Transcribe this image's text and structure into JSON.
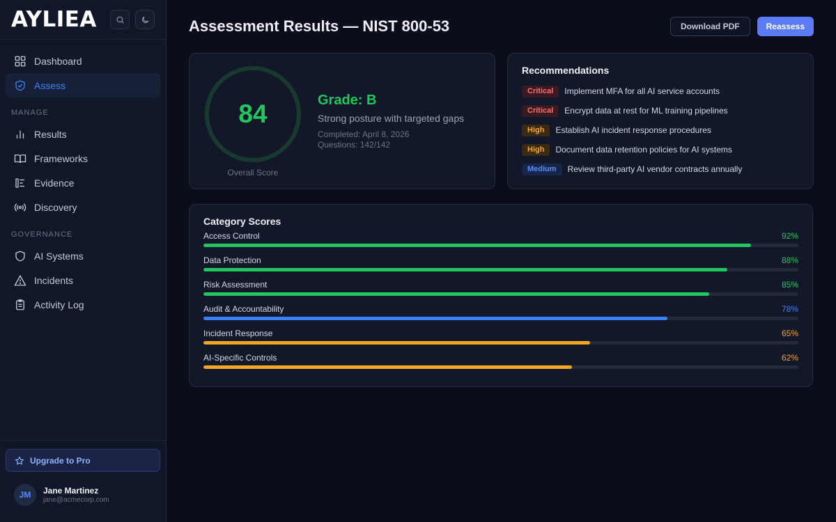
{
  "brand": {
    "name": "AYLIEA"
  },
  "sidebar": {
    "items_top": [
      {
        "label": "Dashboard",
        "icon": "grid-icon",
        "active": false
      },
      {
        "label": "Assess",
        "icon": "shield-check-icon",
        "active": true
      }
    ],
    "section_manage": "MANAGE",
    "items_manage": [
      {
        "label": "Results",
        "icon": "bar-chart-icon"
      },
      {
        "label": "Frameworks",
        "icon": "book-icon"
      },
      {
        "label": "Evidence",
        "icon": "evidence-icon"
      },
      {
        "label": "Discovery",
        "icon": "radio-waves-icon"
      }
    ],
    "section_governance": "GOVERNANCE",
    "items_governance": [
      {
        "label": "AI Systems",
        "icon": "shield-icon"
      },
      {
        "label": "Incidents",
        "icon": "alert-triangle-icon"
      },
      {
        "label": "Activity Log",
        "icon": "clipboard-icon"
      }
    ],
    "upgrade_label": "Upgrade to Pro",
    "user": {
      "initials": "JM",
      "name": "Jane Martinez",
      "email": "jane@acmecorp.com"
    }
  },
  "header": {
    "title": "Assessment Results — NIST 800-53",
    "download_label": "Download PDF",
    "reassess_label": "Reassess"
  },
  "score": {
    "value": "84",
    "fraction": 0.84,
    "label": "Overall Score",
    "grade": "Grade: B",
    "summary": "Strong posture with targeted gaps",
    "completed": "Completed: April 8, 2026",
    "questions": "Questions: 142/142"
  },
  "recommendations": {
    "title": "Recommendations",
    "items": [
      {
        "severity": "Critical",
        "text": "Implement MFA for all AI service accounts"
      },
      {
        "severity": "Critical",
        "text": "Encrypt data at rest for ML training pipelines"
      },
      {
        "severity": "High",
        "text": "Establish AI incident response procedures"
      },
      {
        "severity": "High",
        "text": "Document data retention policies for AI systems"
      },
      {
        "severity": "Medium",
        "text": "Review third-party AI vendor contracts annually"
      }
    ]
  },
  "categories": {
    "title": "Category Scores",
    "items": [
      {
        "name": "Access Control",
        "pct_label": "92%",
        "value": 92,
        "color": "#22c55e"
      },
      {
        "name": "Data Protection",
        "pct_label": "88%",
        "value": 88,
        "color": "#22c55e"
      },
      {
        "name": "Risk Assessment",
        "pct_label": "85%",
        "value": 85,
        "color": "#22c55e"
      },
      {
        "name": "Audit & Accountability",
        "pct_label": "78%",
        "value": 78,
        "color": "#3b82f6"
      },
      {
        "name": "Incident Response",
        "pct_label": "65%",
        "value": 65,
        "color": "#f5a524"
      },
      {
        "name": "AI-Specific Controls",
        "pct_label": "62%",
        "value": 62,
        "color": "#f5a524"
      }
    ]
  },
  "colors": {
    "accent": "#3b82f6",
    "success": "#22c55e",
    "warning": "#f5a524",
    "danger": "#f87171",
    "primary_button": "#5b7cf6"
  }
}
